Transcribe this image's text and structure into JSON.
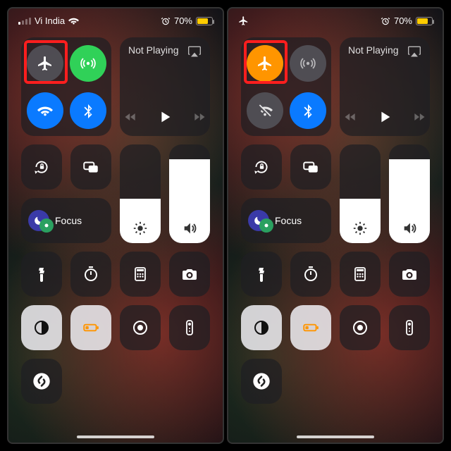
{
  "screens": {
    "left": {
      "statusbar": {
        "carrier": "Vi India",
        "battery_pct": "70%",
        "battery_fill_pct": 70,
        "show_wifi": true,
        "show_alarm": true,
        "show_airplane": false,
        "signal_bars": 1
      },
      "connectivity": {
        "airplane": {
          "state": "off",
          "highlighted": true
        },
        "cellular": {
          "state": "on-green"
        },
        "wifi": {
          "state": "on-blue"
        },
        "bluetooth": {
          "state": "on-blue"
        }
      }
    },
    "right": {
      "statusbar": {
        "carrier": "",
        "battery_pct": "70%",
        "battery_fill_pct": 70,
        "show_wifi": false,
        "show_alarm": true,
        "show_airplane": true,
        "signal_bars": 0
      },
      "connectivity": {
        "airplane": {
          "state": "on-orange",
          "highlighted": true
        },
        "cellular": {
          "state": "off"
        },
        "wifi": {
          "state": "off-slashed"
        },
        "bluetooth": {
          "state": "on-blue"
        }
      }
    }
  },
  "media": {
    "now_playing": "Not Playing"
  },
  "focus": {
    "label": "Focus"
  },
  "brightness": {
    "level_pct": 45
  },
  "volume": {
    "level_pct": 85
  },
  "icons": {
    "airplane": "airplane-icon",
    "cellular": "cellular-icon",
    "wifi": "wifi-icon",
    "bluetooth": "bluetooth-icon",
    "airplay": "airplay-icon",
    "play": "play-icon",
    "prev": "prev-icon",
    "next": "next-icon",
    "rotation_lock": "rotation-lock-icon",
    "screen_mirroring": "screen-mirroring-icon",
    "moon": "moon-icon",
    "brightness": "brightness-icon",
    "volume": "volume-icon",
    "flashlight": "flashlight-icon",
    "timer": "timer-icon",
    "calculator": "calculator-icon",
    "camera": "camera-icon",
    "dark_mode": "dark-mode-icon",
    "low_power": "low-power-icon",
    "screen_record": "screen-record-icon",
    "remote": "remote-icon",
    "shazam": "shazam-icon",
    "alarm": "alarm-icon"
  }
}
